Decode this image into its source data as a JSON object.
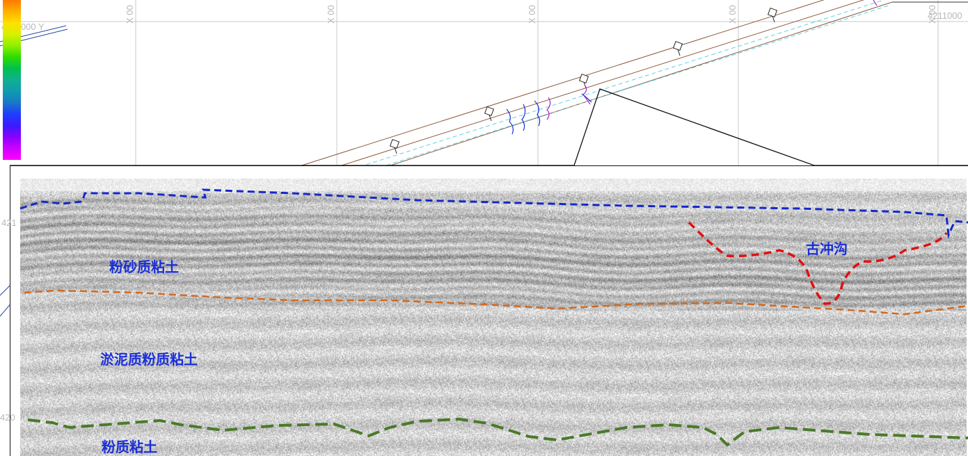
{
  "map": {
    "x_grid_labels": [
      "X 00",
      "X 00",
      "X 00",
      "X 00",
      "X 00"
    ],
    "y_grid_label_top_left": "4211000 Y",
    "y_grid_label_top_right": "4211000",
    "y_grid_label_left_mid": "421",
    "y_grid_label_left_low": "420",
    "colorbar_colors": [
      "#ff00ff",
      "#cc00ff",
      "#8a00ff",
      "#3b1bff",
      "#1f3cff",
      "#1878c8",
      "#0f9bb0",
      "#10b090",
      "#00c050",
      "#2edb00",
      "#8ef000",
      "#d8f000",
      "#ffe000",
      "#ffb000",
      "#ff7a00"
    ]
  },
  "profile": {
    "labels": {
      "silty_sand_clay": "粉砂质粘土",
      "paleochannel": "古冲沟",
      "muddy_silty_clay": "淤泥质粉质粘土",
      "silty_clay": "粉质粘土"
    },
    "line_colors": {
      "seabed": "#1428c8",
      "channel": "#e01010",
      "layer1_base": "#d2691e",
      "layer2_base": "#4a7a2a"
    }
  }
}
